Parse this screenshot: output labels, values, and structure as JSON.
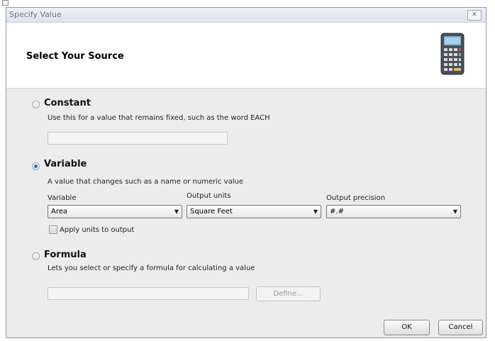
{
  "window": {
    "title": "Specify Value",
    "close_glyph": "✕"
  },
  "header": {
    "title": "Select Your Source",
    "icon": "calculator-icon"
  },
  "constant": {
    "label": "Constant",
    "description": "Use this for a value that remains fixed, such as the word EACH",
    "value": "",
    "selected": false
  },
  "variable": {
    "label": "Variable",
    "description": "A value that changes such as a name or numeric value",
    "selected": true,
    "variable_label": "Variable",
    "variable_value": "Area",
    "units_label": "Output units",
    "units_value": "Square Feet",
    "precision_label": "Output precision",
    "precision_value": "#.#",
    "apply_units_label": "Apply units to output",
    "apply_units_checked": false
  },
  "formula": {
    "label": "Formula",
    "description": "Lets you select or specify a formula for calculating a value",
    "value": "",
    "selected": false,
    "define_label": "Define..."
  },
  "buttons": {
    "ok": "OK",
    "cancel": "Cancel"
  },
  "colors": {
    "accent": "#2c6ec8",
    "dialog_bg": "#ececec",
    "header_bg": "#ffffff"
  }
}
